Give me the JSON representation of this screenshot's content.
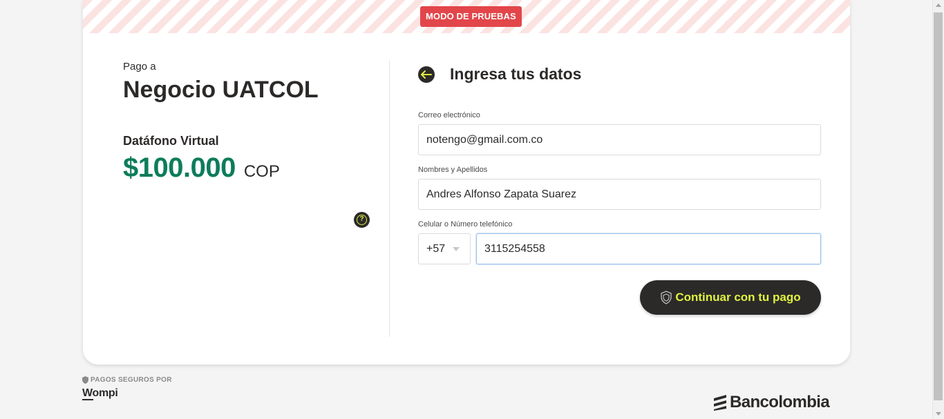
{
  "banner": {
    "test_mode_label": "MODO DE PRUEBAS"
  },
  "summary": {
    "pay_to_label": "Pago a",
    "merchant_name": "Negocio UATCOL",
    "product_name": "Datáfono Virtual",
    "amount": "$100.000",
    "currency": "COP",
    "help_icon": "question-mark-icon"
  },
  "form": {
    "title": "Ingresa tus datos",
    "back_icon": "arrow-left-icon",
    "email": {
      "label": "Correo electrónico",
      "value": "notengo@gmail.com.co"
    },
    "full_name": {
      "label": "Nombres y Apellidos",
      "value": "Andres Alfonso Zapata Suarez"
    },
    "phone": {
      "label": "Celular o Número telefónico",
      "prefix": "+57",
      "value": "3115254558"
    },
    "continue_label": "Continuar con tu pago",
    "continue_icon": "shield-icon"
  },
  "footer": {
    "secure_label": "PAGOS SEGUROS POR",
    "wompi_logo": "Wompi",
    "bancolombia_logo": "Bancolombia"
  },
  "colors": {
    "accent": "#dff140",
    "dark": "#2c2a29",
    "amount": "#0d7c5b",
    "test_badge": "#e2464a"
  }
}
